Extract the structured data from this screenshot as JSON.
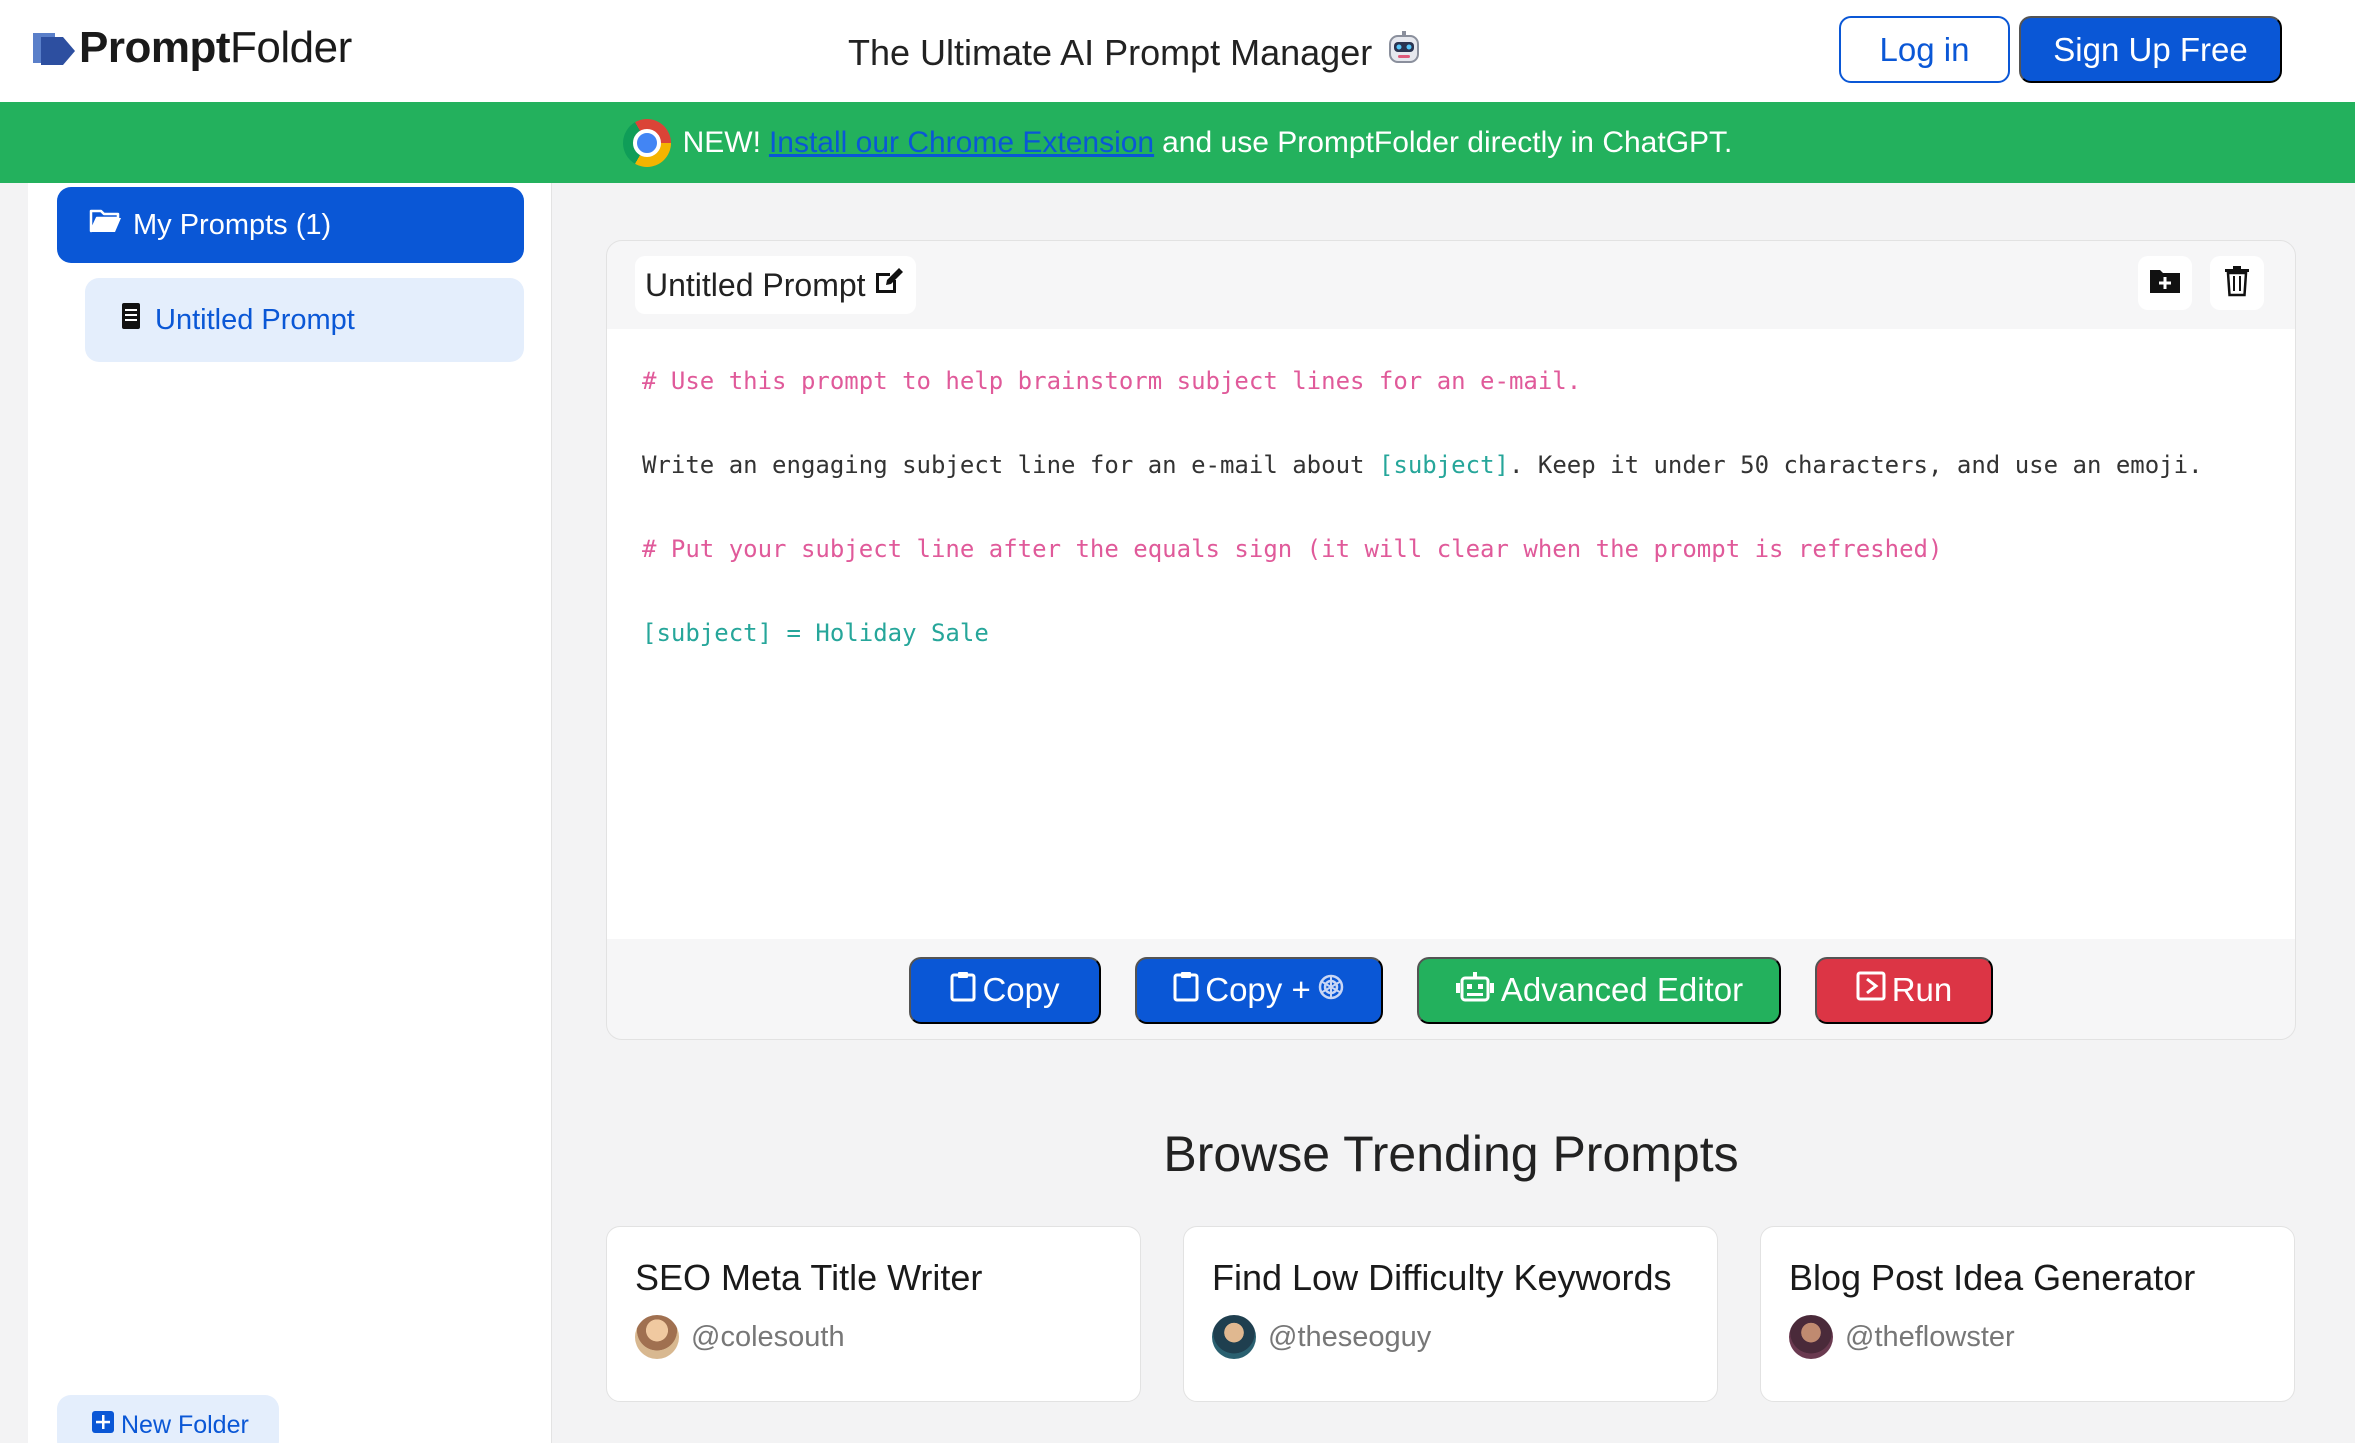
{
  "header": {
    "logo_bold": "Prompt",
    "logo_light": "Folder",
    "tagline": "The Ultimate AI Prompt Manager",
    "login_label": "Log in",
    "signup_label": "Sign Up Free"
  },
  "banner": {
    "prefix": "NEW!",
    "link_text": "Install our Chrome Extension",
    "suffix": "and use PromptFolder directly in ChatGPT."
  },
  "sidebar": {
    "folder_label": "My Prompts (1)",
    "prompt_item_label": "Untitled Prompt",
    "new_folder_label": "New Folder"
  },
  "editor": {
    "title": "Untitled Prompt",
    "line1": "# Use this prompt to help brainstorm subject lines for an e-mail.",
    "line2_a": "Write an engaging subject line for an e-mail about ",
    "line2_var": "[subject]",
    "line2_b": ". Keep it under 50 characters, and use an emoji.",
    "line3": "# Put your subject line after the equals sign (it will clear when the prompt is refreshed)",
    "line4": "[subject] = Holiday Sale"
  },
  "actions": {
    "copy_label": "Copy",
    "copy_plus_label": "Copy +",
    "advanced_label": "Advanced Editor",
    "run_label": "Run"
  },
  "trending": {
    "title": "Browse Trending Prompts",
    "cards": [
      {
        "title": "SEO Meta Title Writer",
        "author": "@colesouth"
      },
      {
        "title": "Find Low Difficulty Keywords",
        "author": "@theseoguy"
      },
      {
        "title": "Blog Post Idea Generator",
        "author": "@theflowster"
      }
    ]
  },
  "colors": {
    "primary": "#0a57d6",
    "success": "#23b15d",
    "danger": "#dc3545",
    "comment": "#e05a9a",
    "variable": "#26a69a"
  }
}
